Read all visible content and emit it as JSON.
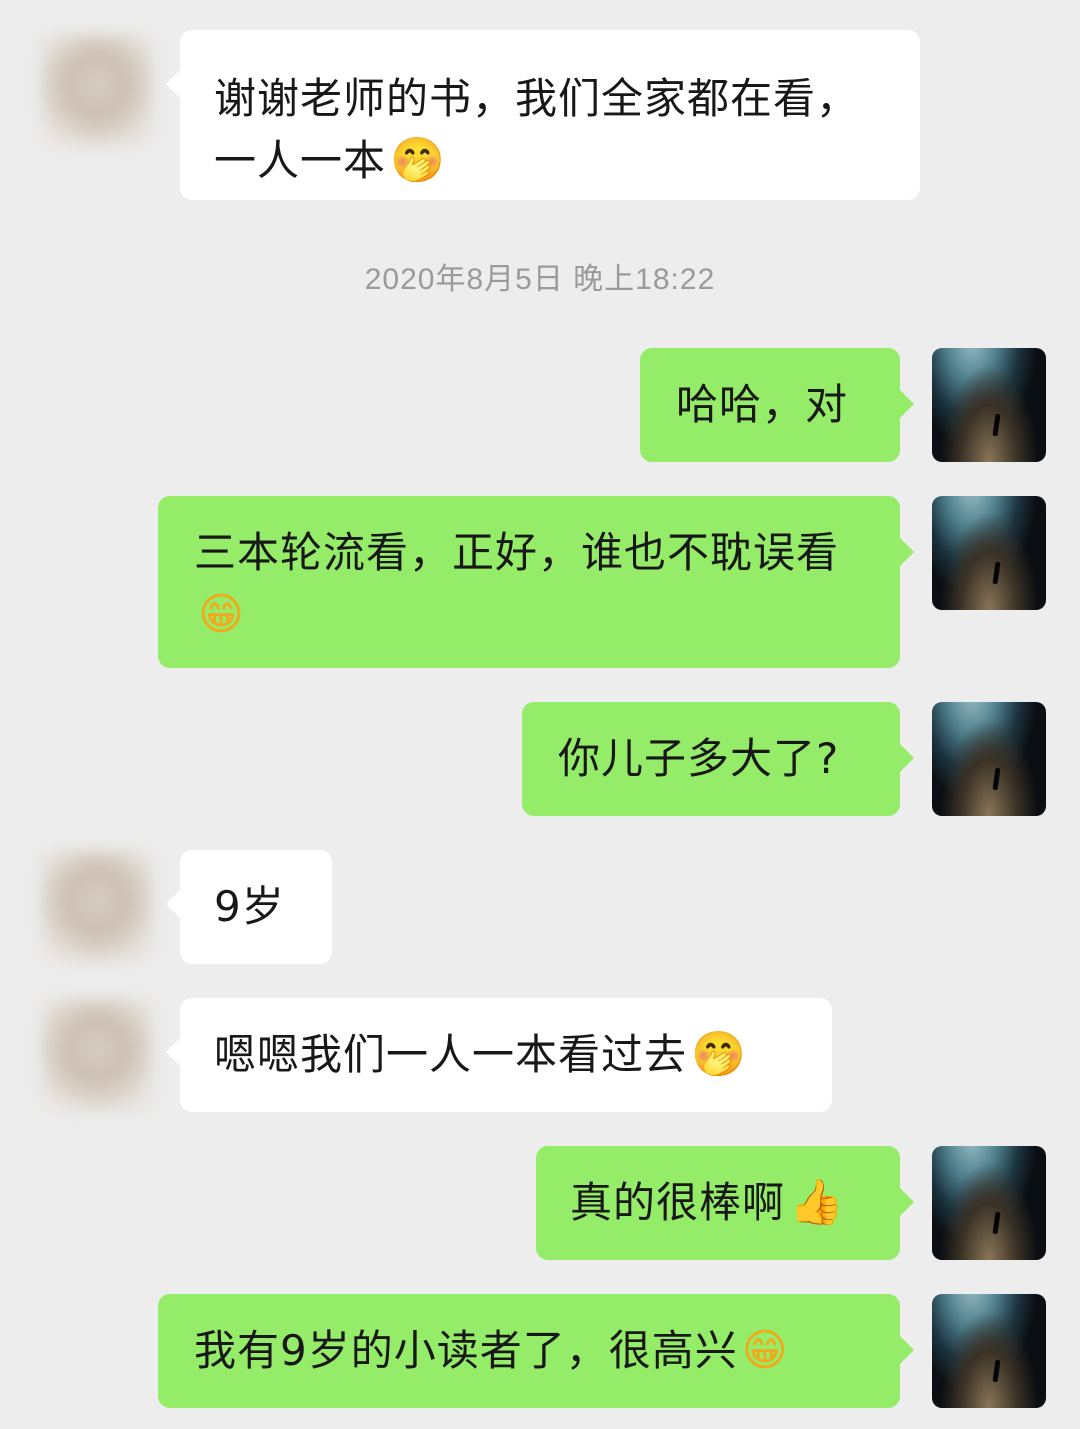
{
  "chat": {
    "timestamp": "2020年8月5日 晚上18:22",
    "messages": [
      {
        "side": "left",
        "text": "谢谢老师的书，我们全家都在看，一人一本",
        "emoji": "🤭",
        "emoji_icon": "hand-over-mouth-emoji-icon"
      },
      {
        "side": "right",
        "text": "哈哈，对",
        "emoji": ""
      },
      {
        "side": "right",
        "text": "三本轮流看，正好，谁也不耽误看",
        "emoji": "😁",
        "emoji_icon": "grin-emoji-icon"
      },
      {
        "side": "right",
        "text": "你儿子多大了?",
        "emoji": ""
      },
      {
        "side": "left",
        "text": "9岁",
        "emoji": ""
      },
      {
        "side": "left",
        "text": "嗯嗯我们一人一本看过去",
        "emoji": "🤭",
        "emoji_icon": "hand-over-mouth-emoji-icon"
      },
      {
        "side": "right",
        "text": "真的很棒啊",
        "emoji": "👍",
        "emoji_icon": "thumbs-up-emoji-icon"
      },
      {
        "side": "right",
        "text": "我有9岁的小读者了，很高兴",
        "emoji": "😁",
        "emoji_icon": "grin-emoji-icon"
      }
    ]
  },
  "colors": {
    "background": "#ededed",
    "sent_bubble": "#95ec69",
    "received_bubble": "#ffffff",
    "timestamp_text": "#9a9a9a"
  }
}
